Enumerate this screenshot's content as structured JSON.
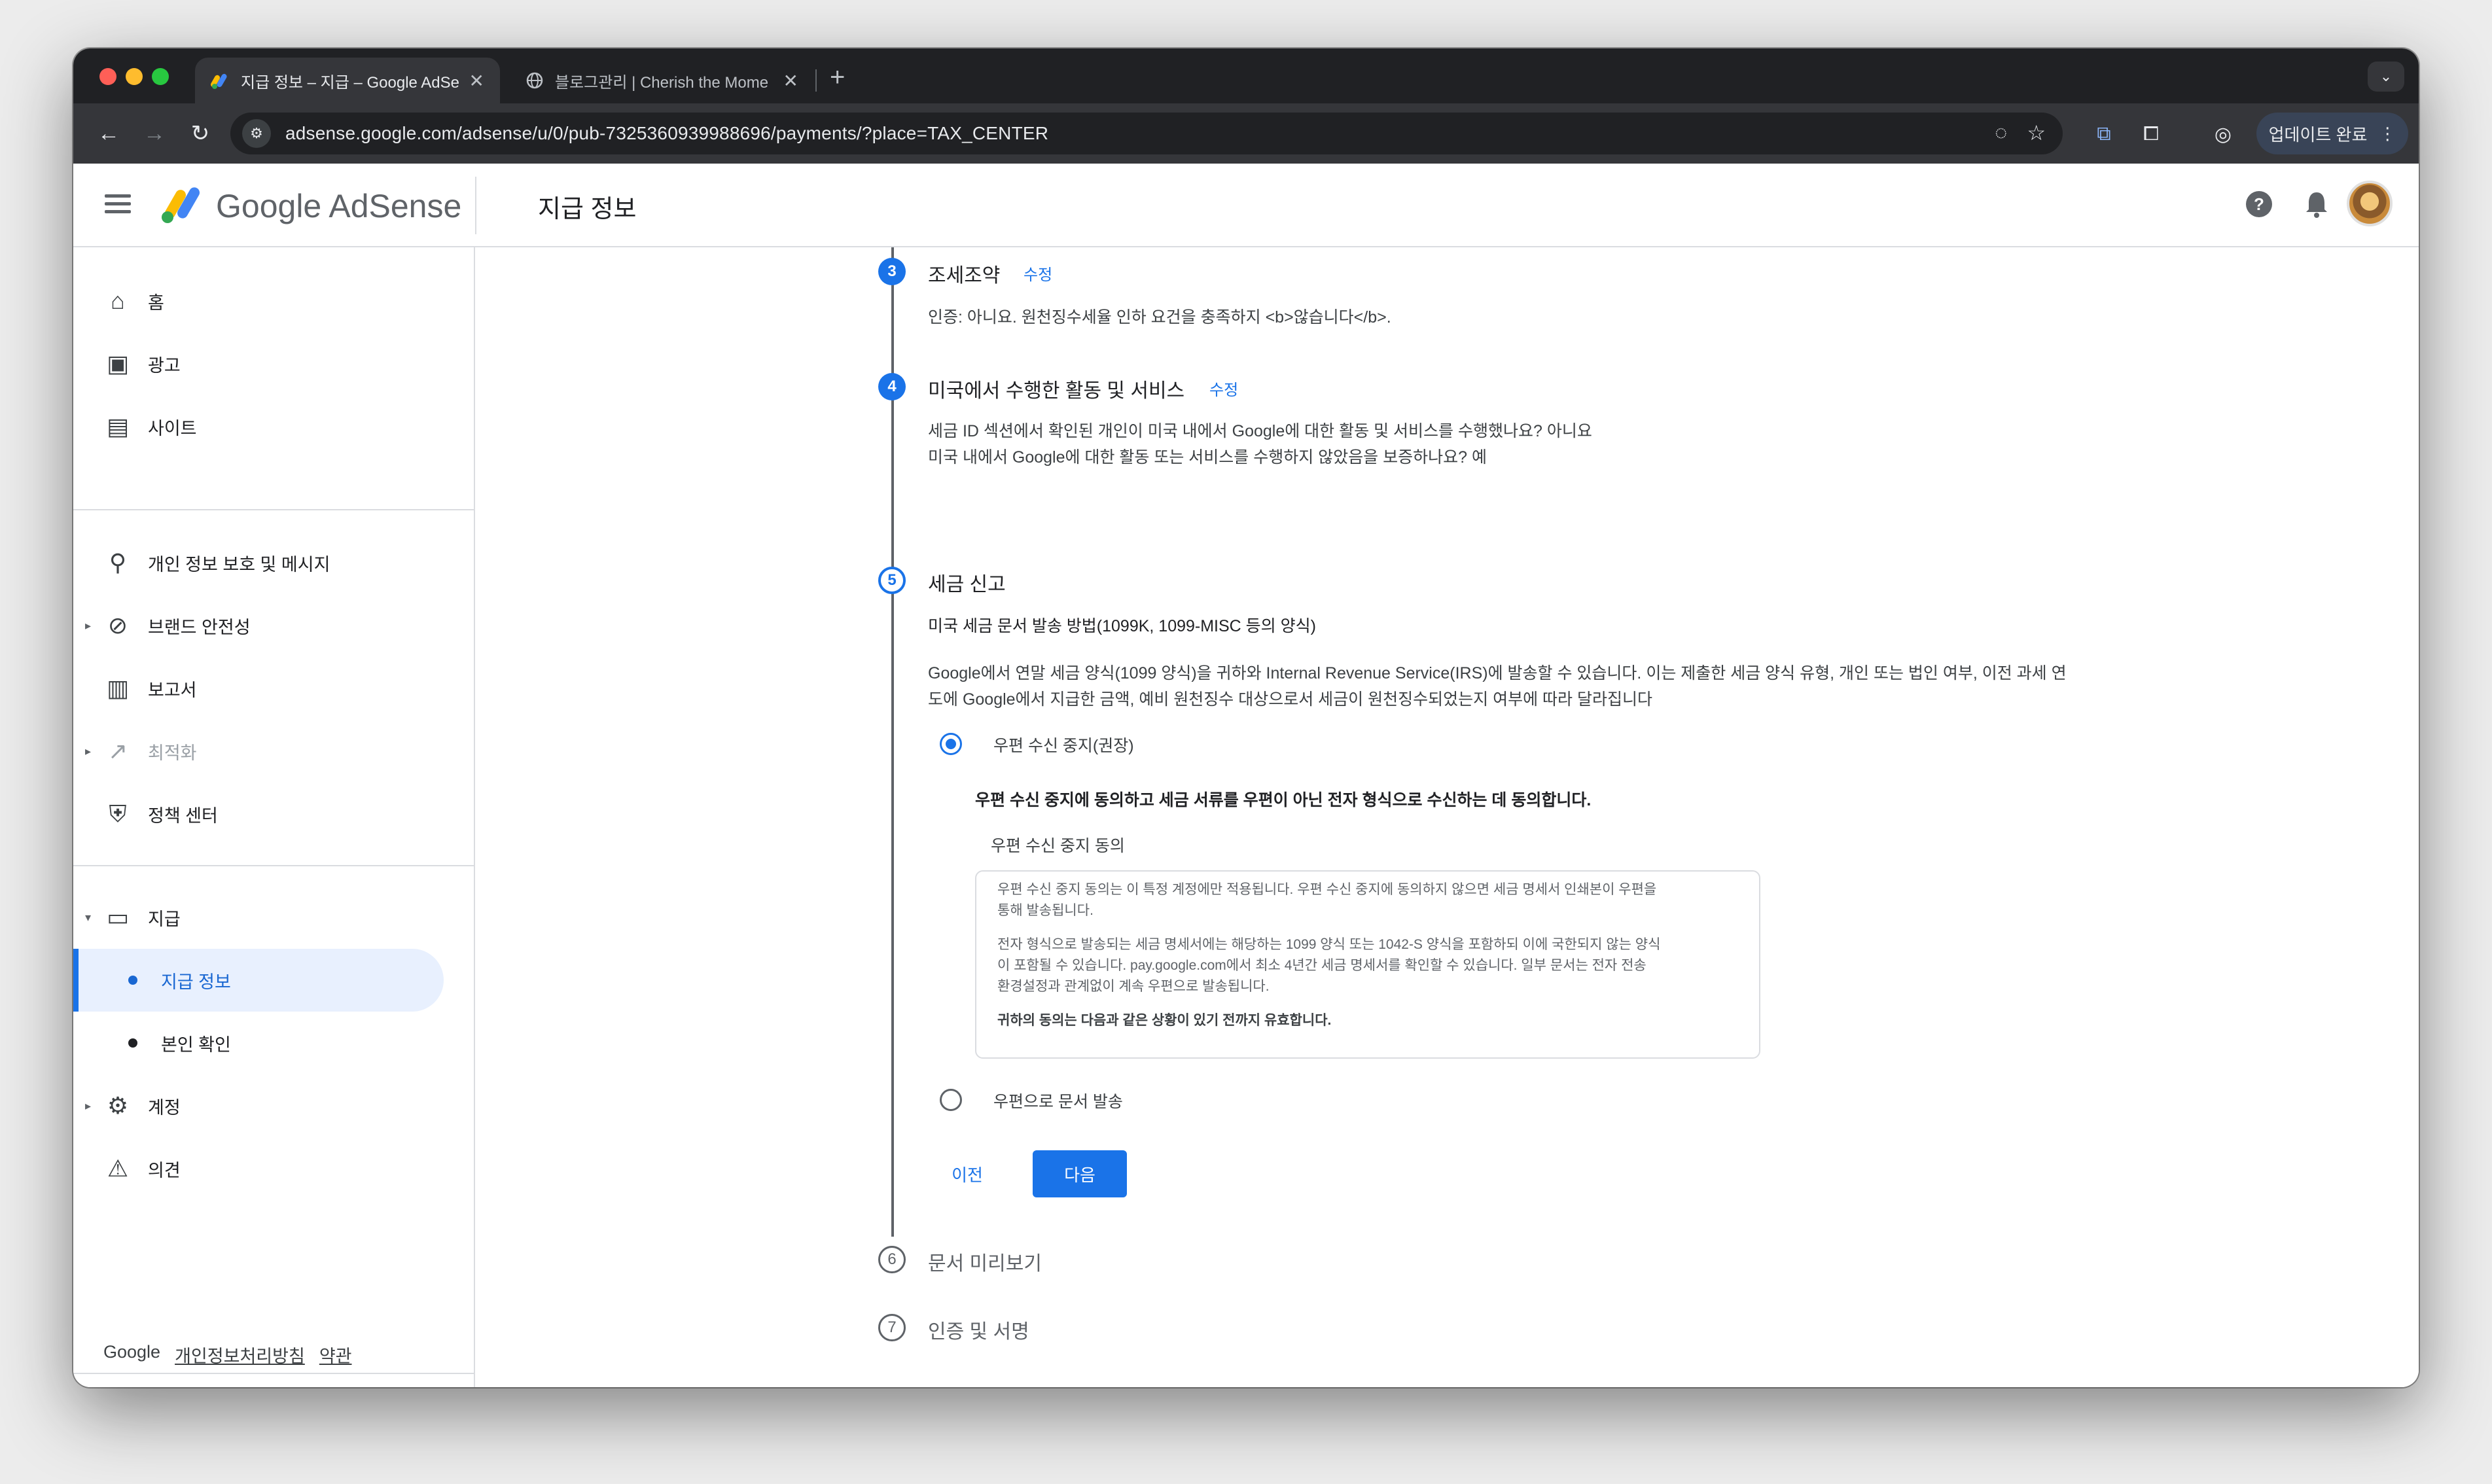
{
  "browser": {
    "tabs": [
      {
        "title": "지급 정보 – 지급 – Google AdSe",
        "active": true
      },
      {
        "title": "블로그관리 | Cherish the Mome",
        "active": false
      }
    ],
    "url": "adsense.google.com/adsense/u/0/pub-7325360939988696/payments/?place=TAX_CENTER",
    "update_label": "업데이트 완료"
  },
  "app": {
    "brand": "Google AdSense",
    "page_title": "지급 정보"
  },
  "sidebar": {
    "items": [
      {
        "label": "홈",
        "icon": "home-icon"
      },
      {
        "label": "광고",
        "icon": "ads-icon"
      },
      {
        "label": "사이트",
        "icon": "sites-icon"
      },
      {
        "label": "개인 정보 보호 및 메시지",
        "icon": "privacy-icon"
      },
      {
        "label": "브랜드 안전성",
        "icon": "block-icon"
      },
      {
        "label": "보고서",
        "icon": "report-icon"
      },
      {
        "label": "최적화",
        "icon": "trending-icon"
      },
      {
        "label": "정책 센터",
        "icon": "policy-icon"
      },
      {
        "label": "지급",
        "icon": "payments-icon"
      },
      {
        "label": "계정",
        "icon": "gear-icon"
      },
      {
        "label": "의견",
        "icon": "feedback-icon"
      }
    ],
    "sub_items": [
      {
        "label": "지급 정보",
        "active": true
      },
      {
        "label": "본인 확인",
        "active": false
      }
    ],
    "footer": {
      "google": "Google",
      "privacy": "개인정보처리방침",
      "terms": "약관"
    }
  },
  "steps": {
    "s3": {
      "num": "3",
      "title": "조세조약",
      "edit": "수정",
      "text": "인증: 아니요. 원천징수세율 인하 요건을 충족하지 <b>않습니다</b>."
    },
    "s4": {
      "num": "4",
      "title": "미국에서 수행한 활동 및 서비스",
      "edit": "수정",
      "line1": "세금 ID 섹션에서 확인된 개인이 미국 내에서 Google에 대한 활동 및 서비스를 수행했나요? 아니요",
      "line2": "미국 내에서 Google에 대한 활동 또는 서비스를 수행하지 않았음을 보증하나요? 예"
    },
    "s5": {
      "num": "5",
      "title": "세금 신고",
      "method": "미국 세금 문서 발송 방법(1099K, 1099-MISC 등의 양식)",
      "desc1": "Google에서 연말 세금 양식(1099 양식)을 귀하와 Internal Revenue Service(IRS)에 발송할 수 있습니다. 이는 제출한 세금 양식 유형, 개인 또는 법인 여부, 이전 과세 연",
      "desc2": "도에 Google에서 지급한 금액, 예비 원천징수 대상으로서 세금이 원천징수되었는지 여부에 따라 달라집니다",
      "option1": "우편 수신 중지(권장)",
      "option1_heading": "우편 수신 중지에 동의하고 세금 서류를 우편이 아닌 전자 형식으로 수신하는 데 동의합니다.",
      "consent_title": "우편 수신 중지 동의",
      "consent_p1a": "우편 수신 중지 동의는 이 특정 계정에만 적용됩니다.  우편 수신 중지에 동의하지 않으면 세금 명세서 인쇄본이 우편을",
      "consent_p1b": "통해 발송됩니다.",
      "consent_p2a": "전자 형식으로 발송되는 세금 명세서에는 해당하는 1099 양식 또는 1042-S 양식을 포함하되 이에 국한되지 않는 양식",
      "consent_p2b": "이 포함될 수 있습니다. pay.google.com에서 최소 4년간 세금 명세서를 확인할 수 있습니다. 일부 문서는 전자 전송",
      "consent_p2c": "환경설정과 관계없이 계속 우편으로 발송됩니다.",
      "consent_p3": "귀하의 동의는 다음과 같은 상황이 있기 전까지 유효합니다.",
      "option2": "우편으로 문서 발송",
      "prev": "이전",
      "next": "다음"
    },
    "s6": {
      "num": "6",
      "title": "문서 미리보기"
    },
    "s7": {
      "num": "7",
      "title": "인증 및 서명"
    }
  },
  "colors": {
    "accent": "#1a73e8",
    "active_bg": "#e8f0fe"
  }
}
